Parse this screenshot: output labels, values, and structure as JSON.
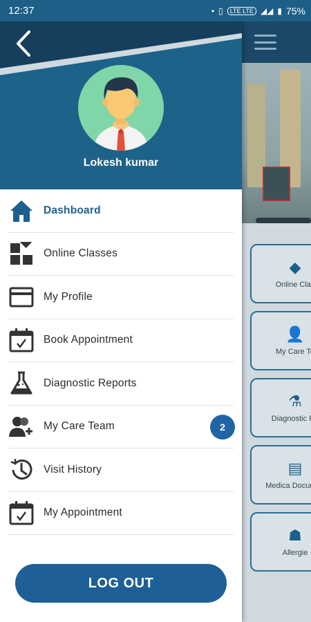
{
  "status": {
    "time": "12:37",
    "network": "LTE LTE",
    "battery": "75%"
  },
  "user": {
    "name": "Lokesh kumar"
  },
  "menu": {
    "items": [
      {
        "label": "Dashboard",
        "icon": "home-icon",
        "active": true
      },
      {
        "label": "Online Classes",
        "icon": "grid-diamond-icon"
      },
      {
        "label": "My Profile",
        "icon": "card-icon"
      },
      {
        "label": "Book Appointment",
        "icon": "calendar-check-icon"
      },
      {
        "label": "Diagnostic Reports",
        "icon": "flask-icon"
      },
      {
        "label": "My Care Team",
        "icon": "add-user-icon",
        "badge": "2"
      },
      {
        "label": "Visit History",
        "icon": "history-icon"
      },
      {
        "label": "My Appointment",
        "icon": "calendar-check-icon"
      }
    ]
  },
  "logout": {
    "label": "LOG OUT"
  },
  "background_cards": [
    {
      "label": "Online Clas",
      "icon": "grid-diamond-icon"
    },
    {
      "label": "My Care Te",
      "icon": "add-user-icon"
    },
    {
      "label": "Diagnostic Re",
      "icon": "flask-icon"
    },
    {
      "label": "Medica Documen",
      "icon": "document-icon"
    },
    {
      "label": "Allergie",
      "icon": "allergy-icon"
    }
  ],
  "colors": {
    "accent": "#1d5f96",
    "header": "#1d6289",
    "header_dark": "#163f5e",
    "badge": "#1f65a6"
  }
}
